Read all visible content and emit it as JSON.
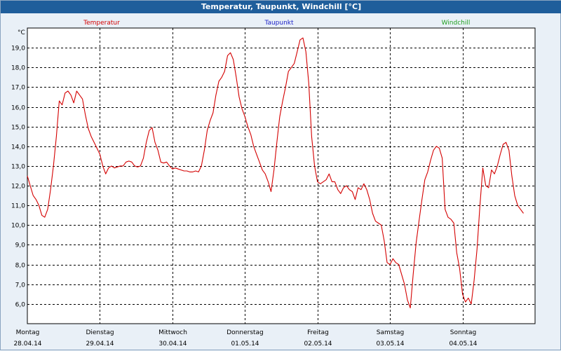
{
  "window": {
    "title": "Temperatur, Taupunkt, Windchill [°C]"
  },
  "colors": {
    "temperature": "#d40000",
    "dewpoint": "#1d22c8",
    "windchill": "#1fa01f",
    "titlebar": "#1f5e9b",
    "plot_background": "#ffffff",
    "grid": "#000000"
  },
  "chart_data": {
    "type": "line",
    "title": "Temperatur, Taupunkt, Windchill [°C]",
    "ylabel": "°C",
    "ylim": [
      5.0,
      20.0
    ],
    "yticks": [
      "6,0",
      "7,0",
      "8,0",
      "9,0",
      "10,0",
      "11,0",
      "12,0",
      "13,0",
      "14,0",
      "15,0",
      "16,0",
      "17,0",
      "18,0",
      "19,0"
    ],
    "xlim": [
      0,
      7
    ],
    "xticks": [
      {
        "day": "Montag",
        "date": "28.04.14"
      },
      {
        "day": "Dienstag",
        "date": "29.04.14"
      },
      {
        "day": "Mittwoch",
        "date": "30.04.14"
      },
      {
        "day": "Donnerstag",
        "date": "01.05.14"
      },
      {
        "day": "Freitag",
        "date": "02.05.14"
      },
      {
        "day": "Samstag",
        "date": "03.05.14"
      },
      {
        "day": "Sonntag",
        "date": "04.05.14"
      }
    ],
    "grid": true,
    "legend": [
      {
        "label": "Temperatur",
        "color": "#d40000"
      },
      {
        "label": "Taupunkt",
        "color": "#1d22c8"
      },
      {
        "label": "Windchill",
        "color": "#1fa01f"
      }
    ],
    "series": [
      {
        "name": "Temperatur",
        "color": "#d40000",
        "points": [
          [
            0.0,
            12.5
          ],
          [
            0.04,
            12.0
          ],
          [
            0.08,
            11.5
          ],
          [
            0.12,
            11.3
          ],
          [
            0.16,
            11.0
          ],
          [
            0.2,
            10.5
          ],
          [
            0.24,
            10.4
          ],
          [
            0.28,
            10.8
          ],
          [
            0.32,
            11.8
          ],
          [
            0.36,
            13.0
          ],
          [
            0.4,
            14.5
          ],
          [
            0.44,
            16.3
          ],
          [
            0.48,
            16.1
          ],
          [
            0.52,
            16.7
          ],
          [
            0.56,
            16.8
          ],
          [
            0.6,
            16.6
          ],
          [
            0.64,
            16.2
          ],
          [
            0.68,
            16.8
          ],
          [
            0.72,
            16.6
          ],
          [
            0.76,
            16.4
          ],
          [
            0.8,
            15.6
          ],
          [
            0.84,
            14.9
          ],
          [
            0.88,
            14.5
          ],
          [
            0.92,
            14.2
          ],
          [
            0.96,
            13.9
          ],
          [
            1.0,
            13.6
          ],
          [
            1.04,
            13.0
          ],
          [
            1.08,
            12.6
          ],
          [
            1.12,
            12.9
          ],
          [
            1.16,
            13.0
          ],
          [
            1.2,
            12.9
          ],
          [
            1.24,
            12.95
          ],
          [
            1.28,
            13.0
          ],
          [
            1.32,
            13.0
          ],
          [
            1.36,
            13.2
          ],
          [
            1.4,
            13.25
          ],
          [
            1.44,
            13.2
          ],
          [
            1.48,
            13.0
          ],
          [
            1.52,
            12.95
          ],
          [
            1.56,
            13.0
          ],
          [
            1.6,
            13.4
          ],
          [
            1.64,
            14.2
          ],
          [
            1.68,
            14.8
          ],
          [
            1.72,
            14.95
          ],
          [
            1.76,
            14.2
          ],
          [
            1.8,
            13.8
          ],
          [
            1.84,
            13.2
          ],
          [
            1.88,
            13.15
          ],
          [
            1.92,
            13.2
          ],
          [
            1.96,
            13.0
          ],
          [
            2.0,
            12.85
          ],
          [
            2.04,
            12.9
          ],
          [
            2.08,
            12.85
          ],
          [
            2.12,
            12.8
          ],
          [
            2.16,
            12.75
          ],
          [
            2.2,
            12.75
          ],
          [
            2.24,
            12.7
          ],
          [
            2.28,
            12.7
          ],
          [
            2.32,
            12.75
          ],
          [
            2.36,
            12.7
          ],
          [
            2.4,
            13.0
          ],
          [
            2.44,
            13.8
          ],
          [
            2.48,
            14.8
          ],
          [
            2.52,
            15.3
          ],
          [
            2.56,
            15.7
          ],
          [
            2.6,
            16.6
          ],
          [
            2.64,
            17.3
          ],
          [
            2.68,
            17.5
          ],
          [
            2.72,
            17.8
          ],
          [
            2.76,
            18.6
          ],
          [
            2.8,
            18.75
          ],
          [
            2.84,
            18.4
          ],
          [
            2.88,
            17.5
          ],
          [
            2.92,
            16.5
          ],
          [
            2.96,
            15.9
          ],
          [
            3.0,
            15.5
          ],
          [
            3.04,
            15.0
          ],
          [
            3.08,
            14.6
          ],
          [
            3.12,
            14.0
          ],
          [
            3.16,
            13.6
          ],
          [
            3.2,
            13.2
          ],
          [
            3.24,
            12.8
          ],
          [
            3.28,
            12.6
          ],
          [
            3.32,
            12.2
          ],
          [
            3.36,
            11.7
          ],
          [
            3.4,
            12.8
          ],
          [
            3.44,
            14.2
          ],
          [
            3.48,
            15.5
          ],
          [
            3.52,
            16.3
          ],
          [
            3.56,
            17.0
          ],
          [
            3.6,
            17.8
          ],
          [
            3.64,
            18.0
          ],
          [
            3.68,
            18.2
          ],
          [
            3.72,
            18.8
          ],
          [
            3.76,
            19.4
          ],
          [
            3.8,
            19.5
          ],
          [
            3.84,
            18.8
          ],
          [
            3.88,
            17.2
          ],
          [
            3.92,
            14.5
          ],
          [
            3.96,
            13.0
          ],
          [
            4.0,
            12.2
          ],
          [
            4.04,
            12.1
          ],
          [
            4.08,
            12.2
          ],
          [
            4.12,
            12.3
          ],
          [
            4.16,
            12.6
          ],
          [
            4.2,
            12.2
          ],
          [
            4.24,
            12.2
          ],
          [
            4.28,
            11.8
          ],
          [
            4.32,
            11.6
          ],
          [
            4.36,
            11.9
          ],
          [
            4.4,
            12.0
          ],
          [
            4.44,
            11.8
          ],
          [
            4.48,
            11.7
          ],
          [
            4.52,
            11.3
          ],
          [
            4.56,
            11.9
          ],
          [
            4.6,
            11.8
          ],
          [
            4.64,
            12.1
          ],
          [
            4.68,
            11.8
          ],
          [
            4.72,
            11.3
          ],
          [
            4.76,
            10.6
          ],
          [
            4.8,
            10.2
          ],
          [
            4.84,
            10.1
          ],
          [
            4.88,
            10.0
          ],
          [
            4.92,
            9.2
          ],
          [
            4.96,
            8.1
          ],
          [
            5.0,
            8.0
          ],
          [
            5.04,
            8.3
          ],
          [
            5.08,
            8.1
          ],
          [
            5.12,
            8.0
          ],
          [
            5.16,
            7.5
          ],
          [
            5.2,
            7.0
          ],
          [
            5.24,
            6.2
          ],
          [
            5.28,
            5.8
          ],
          [
            5.32,
            7.5
          ],
          [
            5.36,
            9.1
          ],
          [
            5.4,
            10.2
          ],
          [
            5.44,
            11.3
          ],
          [
            5.48,
            12.3
          ],
          [
            5.52,
            12.7
          ],
          [
            5.56,
            13.3
          ],
          [
            5.6,
            13.8
          ],
          [
            5.64,
            14.0
          ],
          [
            5.68,
            13.9
          ],
          [
            5.72,
            13.4
          ],
          [
            5.76,
            10.8
          ],
          [
            5.8,
            10.4
          ],
          [
            5.84,
            10.3
          ],
          [
            5.88,
            10.1
          ],
          [
            5.92,
            8.6
          ],
          [
            5.96,
            7.8
          ],
          [
            6.0,
            6.5
          ],
          [
            6.04,
            6.1
          ],
          [
            6.08,
            6.3
          ],
          [
            6.12,
            6.0
          ],
          [
            6.16,
            7.2
          ],
          [
            6.2,
            8.8
          ],
          [
            6.24,
            11.0
          ],
          [
            6.28,
            12.9
          ],
          [
            6.32,
            12.0
          ],
          [
            6.36,
            11.9
          ],
          [
            6.4,
            12.8
          ],
          [
            6.44,
            12.6
          ],
          [
            6.48,
            13.0
          ],
          [
            6.52,
            13.6
          ],
          [
            6.56,
            14.1
          ],
          [
            6.6,
            14.2
          ],
          [
            6.64,
            13.8
          ],
          [
            6.68,
            12.5
          ],
          [
            6.72,
            11.5
          ],
          [
            6.76,
            11.0
          ],
          [
            6.8,
            10.8
          ],
          [
            6.84,
            10.6
          ]
        ]
      }
    ]
  }
}
